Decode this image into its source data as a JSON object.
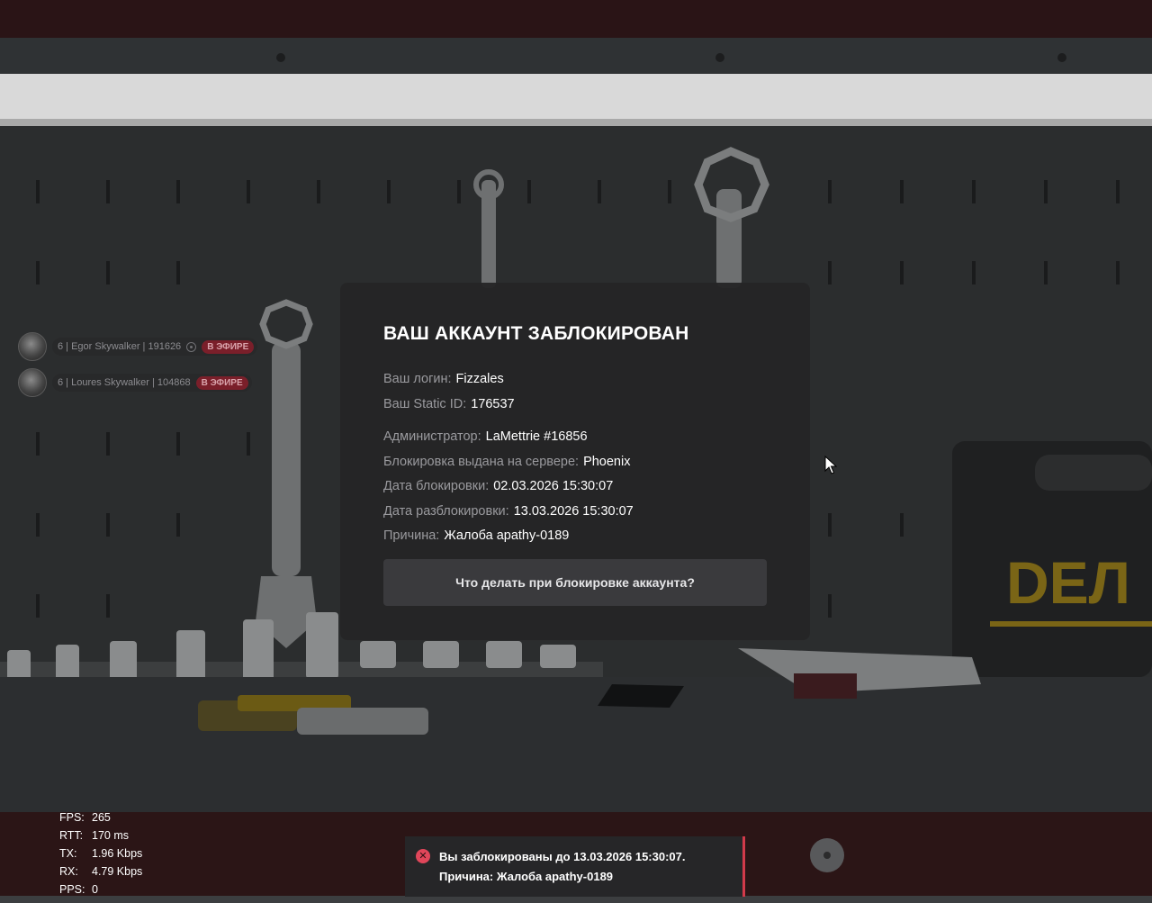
{
  "modal": {
    "title": "ВАШ АККАУНТ ЗАБЛОКИРОВАН",
    "login_label": "Ваш логин:",
    "login_value": "Fizzales",
    "static_id_label": "Ваш Static ID:",
    "static_id_value": "176537",
    "admin_label": "Администратор:",
    "admin_value": "LaMettrie #16856",
    "server_label": "Блокировка выдана на сервере:",
    "server_value": "Phoenix",
    "ban_date_label": "Дата блокировки:",
    "ban_date_value": "02.03.2026 15:30:07",
    "unban_date_label": "Дата разблокировки:",
    "unban_date_value": "13.03.2026 15:30:07",
    "reason_label": "Причина:",
    "reason_value": "Жалоба apathy-0189",
    "help_button": "Что делать при блокировке аккаунта?"
  },
  "voice": {
    "items": [
      {
        "label": "6 | Egor Skywalker | 191626",
        "badge": "В ЭФИРЕ"
      },
      {
        "label": "6 | Loures Skywalker | 104868",
        "badge": "В ЭФИРЕ"
      }
    ]
  },
  "stats": {
    "fps_label": "FPS:",
    "fps_value": "265",
    "rtt_label": "RTT:",
    "rtt_value": "170 ms",
    "tx_label": "TX:",
    "tx_value": "1.96 Kbps",
    "rx_label": "RX:",
    "rx_value": "4.79 Kbps",
    "pps_label": "PPS:",
    "pps_value": "0"
  },
  "notification": {
    "text": "Вы заблокированы до 13.03.2026 15:30:07. Причина: Жалоба apathy-0189",
    "icon": "close-circle-icon",
    "accent": "#d23a4a"
  },
  "background": {
    "brand_text": "DEЛ"
  }
}
